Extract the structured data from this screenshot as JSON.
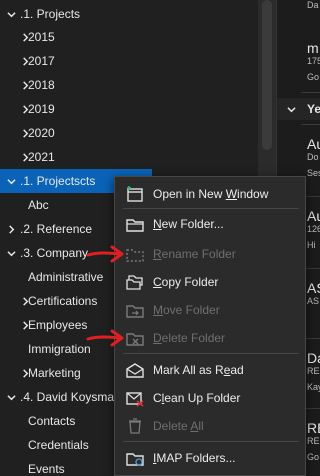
{
  "tree": {
    "items": [
      {
        "label": ".1. Projects",
        "chevron": "down"
      },
      {
        "label": "2015",
        "chevron": "right"
      },
      {
        "label": "2017",
        "chevron": "right"
      },
      {
        "label": "2018",
        "chevron": "right"
      },
      {
        "label": "2019",
        "chevron": "right"
      },
      {
        "label": "2020",
        "chevron": "right"
      },
      {
        "label": "2021",
        "chevron": "right"
      },
      {
        "label": ".1. Projectscts",
        "chevron": "down",
        "selected": true
      },
      {
        "label": "Abc"
      },
      {
        "label": ".2. Reference",
        "chevron": "right"
      },
      {
        "label": ".3. Company",
        "chevron": "down"
      },
      {
        "label": "Administrative"
      },
      {
        "label": "Certifications",
        "chevron": "right"
      },
      {
        "label": "Employees",
        "chevron": "right"
      },
      {
        "label": "Immigration"
      },
      {
        "label": "Marketing",
        "chevron": "right"
      },
      {
        "label": ".4. David Koysman",
        "chevron": "down"
      },
      {
        "label": "Contacts"
      },
      {
        "label": "Credentials"
      },
      {
        "label": "Events"
      }
    ],
    "selected_color": "#0a63b6"
  },
  "message_list": {
    "rows": [
      {
        "text": "Da",
        "style": "small"
      },
      {
        "text": "m",
        "style": "sender"
      },
      {
        "text": "175",
        "style": "small"
      },
      {
        "text": "Go",
        "style": "small"
      },
      {
        "text": "Ye",
        "style": "group"
      },
      {
        "text": "Au",
        "style": "sender"
      },
      {
        "text": "Do",
        "style": "small"
      },
      {
        "text": "Ses",
        "style": "small"
      },
      {
        "text": "Au",
        "style": "sender"
      },
      {
        "text": "126",
        "style": "small"
      },
      {
        "text": "Hi",
        "style": "small"
      },
      {
        "text": "AS",
        "style": "sender"
      },
      {
        "text": "AS",
        "style": "small"
      },
      {
        "text": "Da",
        "style": "sender"
      },
      {
        "text": "RE",
        "style": "small"
      },
      {
        "text": "Kay",
        "style": "small"
      },
      {
        "text": "RE",
        "style": "sender"
      },
      {
        "text": "RE",
        "style": "small"
      },
      {
        "text": "Go",
        "style": "small"
      }
    ]
  },
  "context_menu": {
    "items": [
      {
        "pre": "Open in New ",
        "u": "W",
        "post": "indow",
        "icon": "open-new-window-icon",
        "disabled": false
      },
      {
        "pre": "",
        "u": "N",
        "post": "ew Folder...",
        "icon": "new-folder-icon",
        "disabled": false
      },
      {
        "pre": "",
        "u": "R",
        "post": "ename Folder",
        "icon": "rename-folder-icon",
        "disabled": true
      },
      {
        "pre": "",
        "u": "C",
        "post": "opy Folder",
        "icon": "copy-folder-icon",
        "disabled": false
      },
      {
        "pre": "",
        "u": "M",
        "post": "ove Folder",
        "icon": "move-folder-icon",
        "disabled": true
      },
      {
        "pre": "",
        "u": "D",
        "post": "elete Folder",
        "icon": "delete-folder-icon",
        "disabled": true
      },
      {
        "pre": "Mark All as R",
        "u": "e",
        "post": "ad",
        "icon": "mark-all-read-icon",
        "disabled": false
      },
      {
        "pre": "C",
        "u": "l",
        "post": "ean Up Folder",
        "icon": "clean-up-folder-icon",
        "disabled": false
      },
      {
        "pre": "Delete ",
        "u": "A",
        "post": "ll",
        "icon": "delete-all-icon",
        "disabled": true
      },
      {
        "pre": "",
        "u": "I",
        "post": "MAP Folders...",
        "icon": "imap-folders-icon",
        "disabled": false
      }
    ]
  },
  "colors": {
    "annotation_arrow": "#e02020",
    "menu_bg": "#2b2b2b"
  }
}
